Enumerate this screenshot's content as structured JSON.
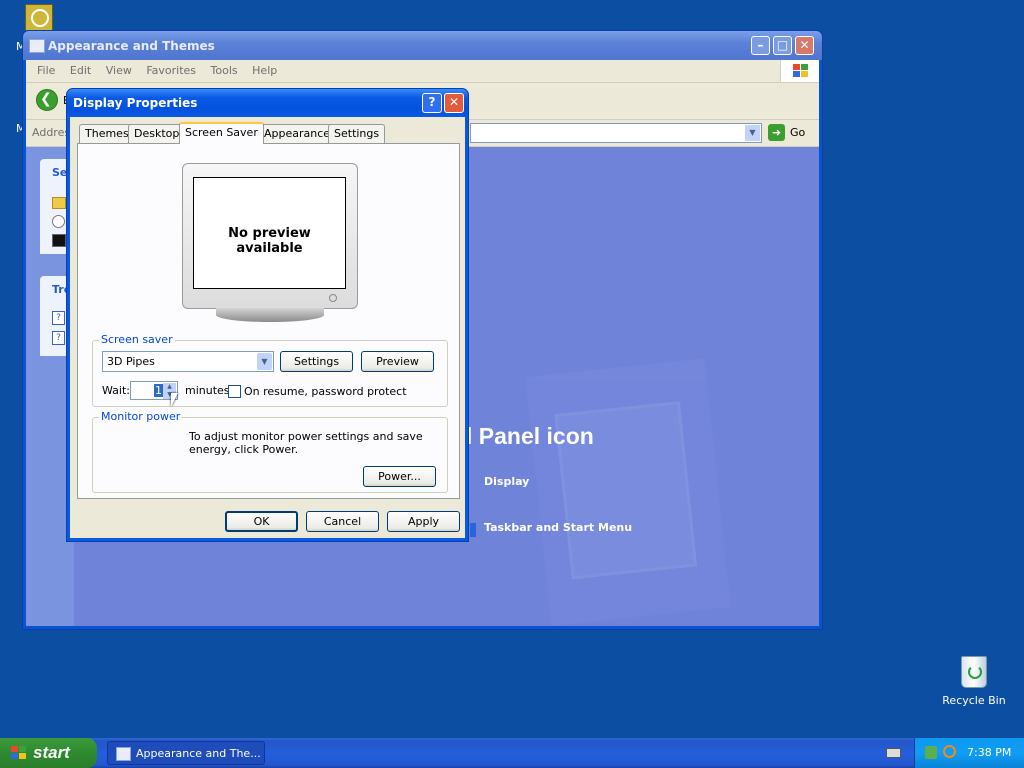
{
  "desktop": {
    "recycle_bin_label": "Recycle Bin",
    "partial_icon_label_1": "M",
    "partial_icon_label_2": "M"
  },
  "explorer": {
    "title": "Appearance and Themes",
    "menu": [
      "File",
      "Edit",
      "View",
      "Favorites",
      "Tools",
      "Help"
    ],
    "back_label": "B",
    "address_label": "Address",
    "go_label": "Go",
    "sidebox_1_title": "Se",
    "sidebox_2_title": "Tro",
    "heading_partial": "l Panel icon",
    "links": [
      "Display",
      "Taskbar and Start Menu"
    ]
  },
  "dialog": {
    "title": "Display Properties",
    "tabs": [
      "Themes",
      "Desktop",
      "Screen Saver",
      "Appearance",
      "Settings"
    ],
    "active_tab": "Screen Saver",
    "preview_text": "No preview available",
    "screen_saver_group": "Screen saver",
    "screen_saver_selected": "3D Pipes",
    "settings_button": "Settings",
    "preview_button": "Preview",
    "wait_label": "Wait:",
    "wait_value": "1",
    "minutes_label": "minutes",
    "password_protect_label": "On resume, password protect",
    "password_protect_checked": false,
    "monitor_power_group": "Monitor power",
    "monitor_power_text": "To adjust monitor power settings and save energy, click Power.",
    "power_button": "Power...",
    "ok_button": "OK",
    "cancel_button": "Cancel",
    "apply_button": "Apply"
  },
  "taskbar": {
    "start_label": "start",
    "task_label": "Appearance and The...",
    "clock": "7:38 PM"
  }
}
